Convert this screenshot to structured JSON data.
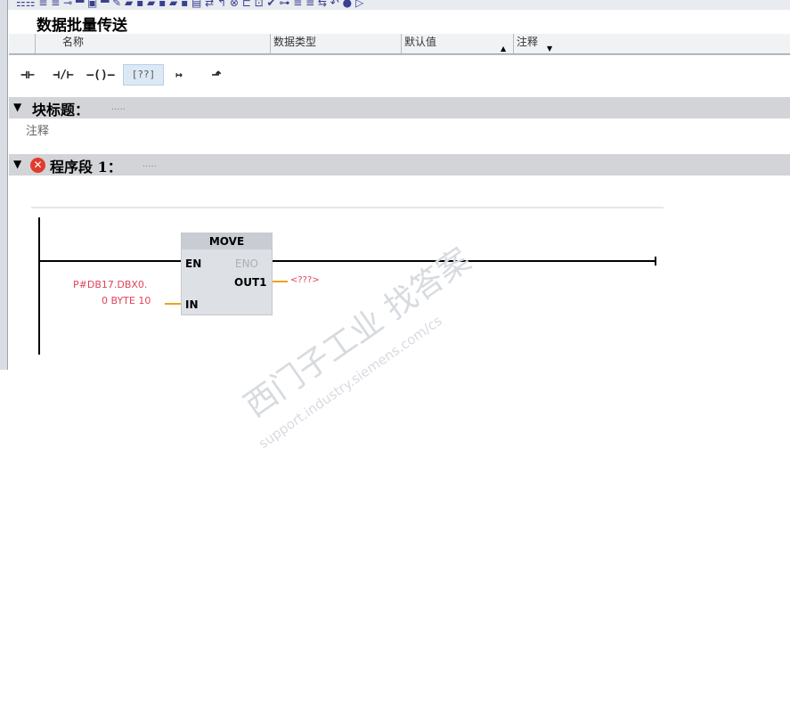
{
  "block": {
    "title": "数据批量传送"
  },
  "interface": {
    "columns": [
      "名称",
      "数据类型",
      "默认值",
      "注释"
    ]
  },
  "ladder_toolbar": {
    "items": [
      {
        "glyph": "⊣⊢",
        "name": "no-contact"
      },
      {
        "glyph": "⊣/⊢",
        "name": "nc-contact"
      },
      {
        "glyph": "–()–",
        "name": "coil"
      },
      {
        "glyph": "[??]",
        "name": "empty-box"
      },
      {
        "glyph": "↦",
        "name": "open-branch"
      },
      {
        "glyph": "⬏",
        "name": "close-branch"
      }
    ]
  },
  "block_title_section": {
    "label": "块标题：",
    "dots": ".....",
    "comment": "注释"
  },
  "network": {
    "label": "程序段 1：",
    "dots": ".....",
    "instruction": "MOVE",
    "pins": {
      "en": "EN",
      "eno": "ENO",
      "out1": "OUT1",
      "in": "IN"
    },
    "in_operand_line1": "P#DB17.DBX0.",
    "in_operand_line2": "0 BYTE 10",
    "out_operand": "<???>"
  },
  "watermark": {
    "line1": "西门子工业 找答案",
    "line2": "support.industry.siemens.com/cs"
  },
  "colors": {
    "section_bg": "#d2d4d8",
    "error_red": "#e23b2e",
    "operand_red": "#e0435b",
    "wire_orange": "#f0a020"
  }
}
